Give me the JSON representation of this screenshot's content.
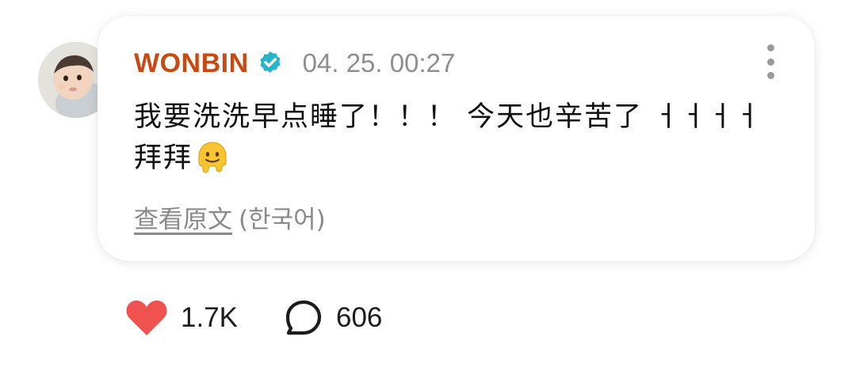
{
  "post": {
    "username": "WONBIN",
    "timestamp": "04. 25. 00:27",
    "message": "我要洗洗早点睡了！！！ 今天也辛苦了 ㅓㅓㅓㅓ 拜拜",
    "emoji_icon": "melting-face-icon",
    "translation_link": "查看原文",
    "translation_lang": "(한국어)"
  },
  "actions": {
    "likes_count": "1.7K",
    "comments_count": "606"
  },
  "colors": {
    "username": "#c84a12",
    "verified_badge": "#29b3c9",
    "heart": "#f0524f",
    "muted_text": "#8f8f8f"
  }
}
